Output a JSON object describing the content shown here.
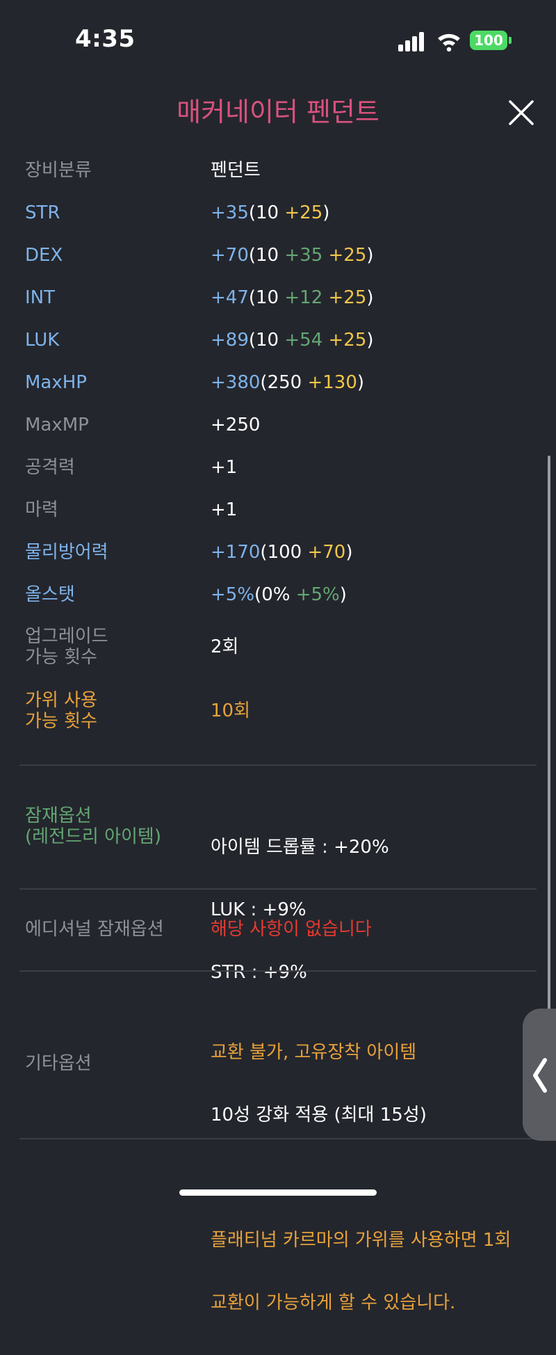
{
  "status_bar": {
    "time": "4:35",
    "battery": "100"
  },
  "title": "매커네이터 펜던트",
  "stats": [
    {
      "label": "장비분류",
      "label_color": "gray",
      "value_parts": [
        {
          "text": "펜던트",
          "color": "white"
        }
      ]
    },
    {
      "label": "STR",
      "label_color": "blue",
      "value_parts": [
        {
          "text": "+35",
          "color": "blue"
        },
        {
          "text": "(10 ",
          "color": "white"
        },
        {
          "text": "+25",
          "color": "yellow"
        },
        {
          "text": ")",
          "color": "white"
        }
      ]
    },
    {
      "label": "DEX",
      "label_color": "blue",
      "value_parts": [
        {
          "text": "+70",
          "color": "blue"
        },
        {
          "text": "(10 ",
          "color": "white"
        },
        {
          "text": "+35 ",
          "color": "green"
        },
        {
          "text": "+25",
          "color": "yellow"
        },
        {
          "text": ")",
          "color": "white"
        }
      ]
    },
    {
      "label": "INT",
      "label_color": "blue",
      "value_parts": [
        {
          "text": "+47",
          "color": "blue"
        },
        {
          "text": "(10 ",
          "color": "white"
        },
        {
          "text": "+12 ",
          "color": "green"
        },
        {
          "text": "+25",
          "color": "yellow"
        },
        {
          "text": ")",
          "color": "white"
        }
      ]
    },
    {
      "label": "LUK",
      "label_color": "blue",
      "value_parts": [
        {
          "text": "+89",
          "color": "blue"
        },
        {
          "text": "(10 ",
          "color": "white"
        },
        {
          "text": "+54 ",
          "color": "green"
        },
        {
          "text": "+25",
          "color": "yellow"
        },
        {
          "text": ")",
          "color": "white"
        }
      ]
    },
    {
      "label": "MaxHP",
      "label_color": "blue",
      "value_parts": [
        {
          "text": "+380",
          "color": "blue"
        },
        {
          "text": "(250 ",
          "color": "white"
        },
        {
          "text": "+130",
          "color": "yellow"
        },
        {
          "text": ")",
          "color": "white"
        }
      ]
    },
    {
      "label": "MaxMP",
      "label_color": "gray",
      "value_parts": [
        {
          "text": "+250",
          "color": "white"
        }
      ]
    },
    {
      "label": "공격력",
      "label_color": "gray",
      "value_parts": [
        {
          "text": "+1",
          "color": "white"
        }
      ]
    },
    {
      "label": "마력",
      "label_color": "gray",
      "value_parts": [
        {
          "text": "+1",
          "color": "white"
        }
      ]
    },
    {
      "label": "물리방어력",
      "label_color": "blue",
      "value_parts": [
        {
          "text": "+170",
          "color": "blue"
        },
        {
          "text": "(100 ",
          "color": "white"
        },
        {
          "text": "+70",
          "color": "yellow"
        },
        {
          "text": ")",
          "color": "white"
        }
      ]
    },
    {
      "label": "올스탯",
      "label_color": "blue",
      "value_parts": [
        {
          "text": "+5%",
          "color": "blue"
        },
        {
          "text": "(0% ",
          "color": "white"
        },
        {
          "text": "+5%",
          "color": "green"
        },
        {
          "text": ")",
          "color": "white"
        }
      ]
    }
  ],
  "upgrade": {
    "label_line1": "업그레이드",
    "label_line2": "가능 횟수",
    "value": "2회"
  },
  "scissors": {
    "label_line1": "가위 사용",
    "label_line2": "가능 횟수",
    "value": "10회"
  },
  "potential": {
    "label_line1": "잠재옵션",
    "label_line2": "(레전드리 아이템)",
    "lines": [
      "아이템 드롭률 : +20%",
      "LUK : +9%",
      "STR : +9%"
    ]
  },
  "additional": {
    "label": "에디셔널 잠재옵션",
    "value": "해당 사항이 없습니다"
  },
  "etc": {
    "label": "기타옵션",
    "line1": "교환 불가, 고유장착 아이템",
    "line2": "10성 강화 적용 (최대 15성)",
    "line3": "플래티넘 카르마의 가위를 사용하면 1회",
    "line4": "교환이 가능하게 할 수 있습니다."
  },
  "colors": {
    "background": "#24262d",
    "title": "#d8527e",
    "gray": "#8f9198",
    "blue": "#7eb3ea",
    "white": "#ffffff",
    "yellow": "#f0c74a",
    "green": "#63a774",
    "orange": "#e8a23a",
    "red": "#e63a30"
  }
}
